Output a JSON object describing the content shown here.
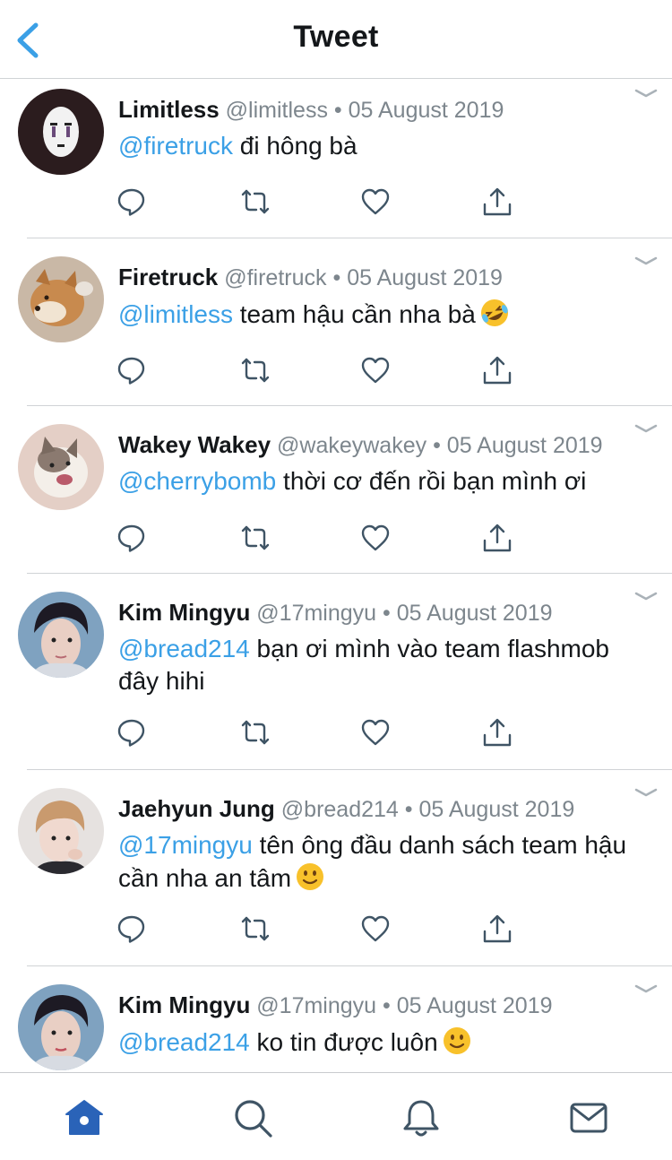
{
  "header": {
    "title": "Tweet",
    "back_icon": "chevron-left-icon"
  },
  "colors": {
    "accent": "#3ba0e6",
    "text": "#14171a",
    "secondary": "#7d868d",
    "divider": "#d0d3d6",
    "active_tab": "#2a63b8"
  },
  "tweets": [
    {
      "name": "Limitless",
      "handle": "@limitless",
      "dot": "•",
      "date": "05 August 2019",
      "mention": "@firetruck",
      "text": "đi hông bà",
      "emoji": ""
    },
    {
      "name": "Firetruck",
      "handle": "@firetruck",
      "dot": "•",
      "date": "05 August 2019",
      "mention": "@limitless",
      "text": "team hậu cần nha bà",
      "emoji": "rolling-laughing"
    },
    {
      "name": "Wakey Wakey",
      "handle": "@wakeywakey",
      "dot": "•",
      "date": "05 August 2019",
      "mention": "@cherrybomb",
      "text": "thời cơ đến rồi bạn mình ơi",
      "emoji": ""
    },
    {
      "name": "Kim Mingyu",
      "handle": "@17mingyu",
      "dot": "•",
      "date": "05 August 2019",
      "mention": "@bread214",
      "text": "bạn ơi mình vào team flashmob đây hihi",
      "emoji": ""
    },
    {
      "name": "Jaehyun Jung",
      "handle": "@bread214",
      "dot": "•",
      "date": "05 August 2019",
      "mention": "@17mingyu",
      "text": "tên ông đầu danh sách team hậu cần nha an tâm",
      "emoji": "slight-smile"
    },
    {
      "name": "Kim Mingyu",
      "handle": "@17mingyu",
      "dot": "•",
      "date": "05 August 2019",
      "mention": "@bread214",
      "text": "ko tin được luôn",
      "emoji": "slight-smile"
    }
  ],
  "action_icons": [
    "reply-icon",
    "retweet-icon",
    "like-icon",
    "share-icon"
  ],
  "tabbar": {
    "tabs": [
      {
        "name": "home",
        "icon": "home-icon",
        "active": true
      },
      {
        "name": "search",
        "icon": "search-icon",
        "active": false
      },
      {
        "name": "notifications",
        "icon": "bell-icon",
        "active": false
      },
      {
        "name": "messages",
        "icon": "mail-icon",
        "active": false
      }
    ]
  }
}
